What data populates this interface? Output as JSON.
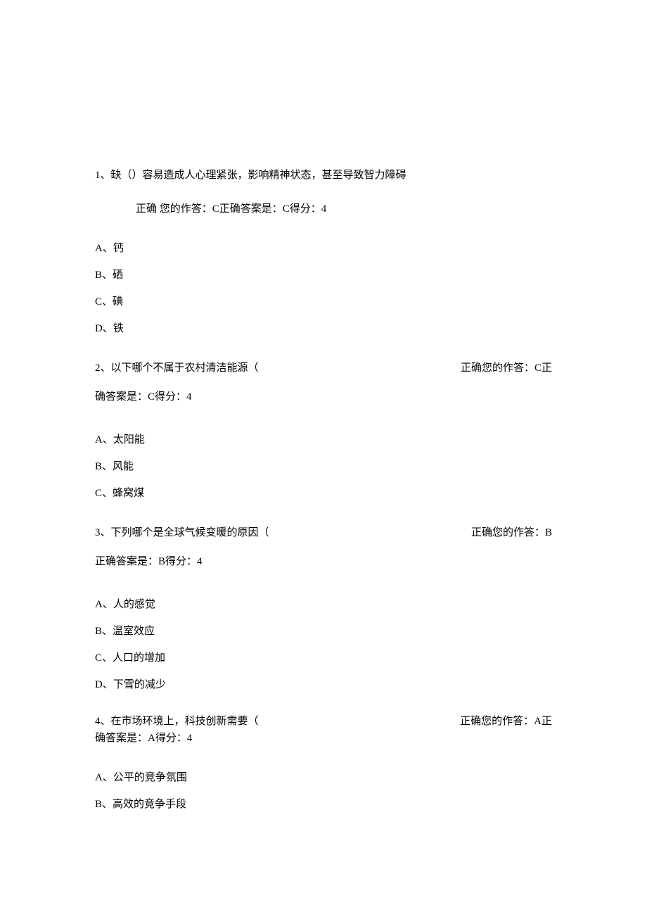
{
  "q1": {
    "text": "1、缺（）容易造成人心理紧张，影响精神状态，甚至导致智力障碍",
    "feedback": "正确 您的作答：C正确答案是：C得分：4",
    "opts": {
      "a": "A、钙",
      "b": "B、硒",
      "c": "C、碘",
      "d": "D、铁"
    }
  },
  "q2": {
    "text": "2、以下哪个不属于农村清洁能源（",
    "fb1": "正确您的作答：C正",
    "fb2": "确答案是：C得分：4",
    "opts": {
      "a": "A、太阳能",
      "b": "B、风能",
      "c": "C、蜂窝煤"
    }
  },
  "q3": {
    "text": "3、下列哪个是全球气候变暖的原因（",
    "fb1": "正确您的作答：B",
    "fb2": "正确答案是：B得分：4",
    "opts": {
      "a": "A、人的感觉",
      "b": "B、温室效应",
      "c": "C、人口的增加",
      "d": "D、下雪的减少"
    }
  },
  "q4": {
    "text": "4、在市场环境上，科技创新需要（",
    "fb1": "正确您的作答：A正",
    "fb2": "确答案是：A得分：4",
    "opts": {
      "a": "A、公平的竞争氛围",
      "b": "B、高效的竞争手段"
    }
  }
}
